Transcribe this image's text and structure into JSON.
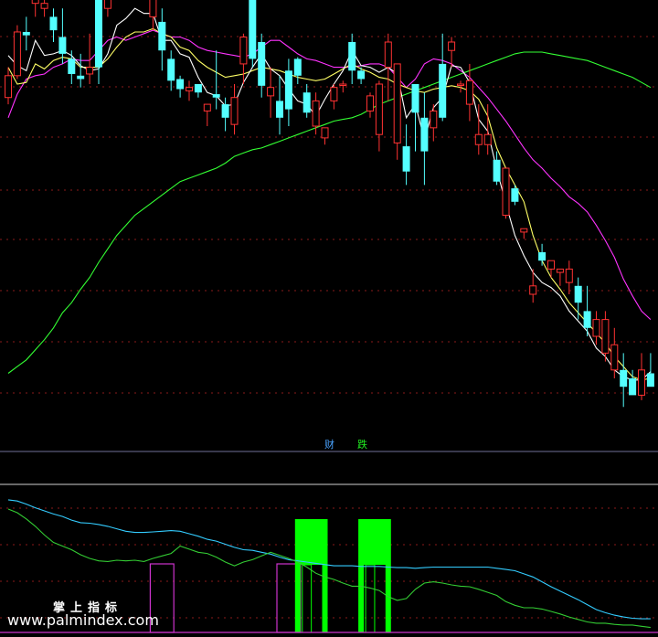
{
  "watermark": {
    "line1": "掌上指标",
    "line2": "www.palmindex.com"
  },
  "indicator_labels": [
    {
      "text": "财",
      "color": "#4aa3ff"
    },
    {
      "text": "跌",
      "color": "#22ee22"
    }
  ],
  "colors": {
    "up": "#ff3232",
    "down": "#54ffff",
    "ma5": "#ffffff",
    "ma10": "#ffff66",
    "ma20": "#ff33ff",
    "ma60": "#33ff33",
    "grid": "#8a1a1a",
    "separator": "#6f6f99",
    "sub_white": "#e6e6e6",
    "sub_cyan": "#33ccff",
    "sub_green": "#33cc33",
    "sub_magenta": "#cc33cc",
    "signal_fill": "#00ff00"
  },
  "chart_data": [
    {
      "type": "candlestick",
      "title": "",
      "candles": [
        [
          92,
          105,
          88,
          110
        ],
        [
          105,
          131,
          103,
          135
        ],
        [
          131,
          129,
          120,
          140
        ],
        [
          148,
          152,
          140,
          157
        ],
        [
          145,
          148,
          140,
          165
        ],
        [
          140,
          132,
          125,
          145
        ],
        [
          128,
          118,
          112,
          145
        ],
        [
          115,
          106,
          100,
          120
        ],
        [
          105,
          103,
          98,
          118
        ],
        [
          106,
          110,
          100,
          130
        ],
        [
          150,
          110,
          100,
          155
        ],
        [
          145,
          173,
          140,
          178
        ],
        [
          176,
          190,
          170,
          195
        ],
        [
          190,
          175,
          170,
          195
        ],
        [
          168,
          185,
          160,
          195
        ],
        [
          186,
          162,
          158,
          190
        ],
        [
          140,
          160,
          132,
          162
        ],
        [
          137,
          120,
          108,
          145
        ],
        [
          115,
          102,
          96,
          120
        ],
        [
          103,
          97,
          92,
          105
        ],
        [
          96,
          98,
          90,
          102
        ],
        [
          100,
          95,
          92,
          100
        ],
        [
          84,
          88,
          75,
          88
        ],
        [
          94,
          92,
          85,
          120
        ],
        [
          88,
          80,
          72,
          92
        ],
        [
          76,
          92,
          70,
          100
        ],
        [
          112,
          128,
          100,
          130
        ],
        [
          150,
          115,
          110,
          170
        ],
        [
          125,
          99,
          92,
          130
        ],
        [
          93,
          98,
          80,
          110
        ],
        [
          90,
          80,
          70,
          105
        ],
        [
          108,
          85,
          75,
          115
        ],
        [
          115,
          105,
          100,
          116
        ],
        [
          95,
          83,
          80,
          100
        ],
        [
          75,
          90,
          70,
          95
        ],
        [
          68,
          74,
          64,
          72
        ],
        [
          90,
          98,
          85,
          100
        ],
        [
          100,
          100,
          95,
          102
        ],
        [
          125,
          108,
          100,
          130
        ],
        [
          108,
          103,
          100,
          110
        ],
        [
          84,
          93,
          80,
          95
        ],
        [
          70,
          100,
          60,
          102
        ],
        [
          110,
          125,
          90,
          130
        ],
        [
          65,
          112,
          55,
          112
        ],
        [
          63,
          48,
          40,
          76
        ],
        [
          100,
          83,
          60,
          100
        ],
        [
          80,
          60,
          40,
          95
        ],
        [
          74,
          84,
          66,
          88
        ],
        [
          112,
          80,
          78,
          130
        ],
        [
          120,
          125,
          110,
          128
        ],
        [
          100,
          100,
          95,
          102
        ],
        [
          88,
          102,
          78,
          112
        ],
        [
          64,
          70,
          58,
          88
        ],
        [
          64,
          70,
          58,
          88
        ],
        [
          55,
          42,
          40,
          60
        ],
        [
          22,
          50,
          20,
          50
        ],
        [
          38,
          30,
          28,
          40
        ],
        [
          12,
          14,
          8,
          14
        ],
        [
          -25,
          -20,
          -30,
          -10
        ],
        [
          0,
          -5,
          -8,
          5
        ],
        [
          -10,
          -5,
          -15,
          -5
        ],
        [
          -12,
          -10,
          -20,
          -10
        ],
        [
          -18,
          -10,
          -25,
          -5
        ],
        [
          -20,
          -30,
          -40,
          -15
        ],
        [
          -35,
          -45,
          -50,
          -20
        ],
        [
          -50,
          -40,
          -55,
          -35
        ],
        [
          -60,
          -40,
          -65,
          -35
        ],
        [
          -70,
          -55,
          -75,
          -45
        ],
        [
          -70,
          -80,
          -92,
          -60
        ],
        [
          -75,
          -85,
          -82,
          -70
        ],
        [
          -85,
          -70,
          -88,
          -60
        ],
        [
          -72,
          -80,
          -72,
          -60
        ]
      ],
      "ma5": [
        117,
        111,
        108,
        126,
        117,
        118,
        120,
        117,
        111,
        108,
        109,
        118,
        135,
        139,
        145,
        142,
        142,
        126,
        126,
        118,
        116,
        104,
        95,
        93,
        87,
        88,
        101,
        110,
        118,
        109,
        105,
        97,
        90,
        88,
        81,
        91,
        100,
        108,
        120,
        111,
        110,
        107,
        110,
        106,
        80,
        88,
        67,
        86,
        92,
        111,
        110,
        101,
        79,
        72,
        49,
        29,
        10,
        -2,
        -12,
        -18,
        -21,
        -26,
        -35,
        -41,
        -47,
        -57,
        -62,
        -70,
        -74,
        -76,
        -76,
        -71
      ],
      "ma10": [
        110,
        100,
        101,
        112,
        109,
        114,
        116,
        115,
        110,
        110,
        110,
        115,
        122,
        128,
        131,
        131,
        133,
        130,
        128,
        122,
        120,
        114,
        110,
        107,
        104,
        105,
        106,
        108,
        110,
        109,
        108,
        106,
        104,
        103,
        102,
        103,
        106,
        109,
        112,
        109,
        107,
        104,
        103,
        100,
        98,
        96,
        95,
        97,
        98,
        99,
        98,
        96,
        91,
        81,
        62,
        50,
        40,
        30,
        10,
        -5,
        -15,
        -22,
        -30,
        -36,
        -42,
        -48,
        -54,
        -62,
        -68,
        -74,
        -76,
        -75
      ],
      "ma20": [
        80,
        94,
        103,
        105,
        106,
        110,
        112,
        115,
        114,
        114,
        120,
        126,
        128,
        126,
        128,
        130,
        132,
        130,
        128,
        128,
        126,
        122,
        120,
        119,
        118,
        117,
        116,
        118,
        122,
        126,
        126,
        122,
        118,
        115,
        114,
        112,
        110,
        110,
        110,
        111,
        112,
        112,
        110,
        104,
        98,
        103,
        112,
        115,
        114,
        112,
        108,
        104,
        98,
        92,
        85,
        78,
        70,
        62,
        55,
        50,
        44,
        39,
        33,
        29,
        24,
        16,
        7,
        -3,
        -16,
        -26,
        -35,
        -40
      ],
      "ma60": [
        -72,
        -68,
        -64,
        -58,
        -52,
        -45,
        -36,
        -30,
        -22,
        -15,
        -6,
        2,
        10,
        16,
        22,
        26,
        30,
        34,
        38,
        42,
        44,
        46,
        48,
        50,
        53,
        57,
        59,
        61,
        62,
        64,
        66,
        68,
        70,
        72,
        74,
        76,
        78,
        79,
        80,
        82,
        85,
        88,
        90,
        92,
        94,
        96,
        98,
        100,
        102,
        104,
        106,
        108,
        110,
        112,
        114,
        116,
        118,
        119,
        119,
        119,
        118,
        117,
        116,
        115,
        114,
        112,
        110,
        108,
        106,
        104,
        101,
        98
      ],
      "ylim": [
        -100,
        150
      ],
      "grid": true
    },
    {
      "type": "line",
      "title": "",
      "series": [
        {
          "color": "#33ccff",
          "values": [
            95,
            93,
            88,
            82,
            77,
            72,
            68,
            62,
            58,
            57,
            55,
            52,
            48,
            44,
            42,
            42,
            43,
            44,
            45,
            44,
            40,
            36,
            31,
            28,
            23,
            18,
            14,
            13,
            10,
            7,
            2,
            -2,
            -4,
            -6,
            -8,
            -10,
            -12,
            -12,
            -12,
            -13,
            -13,
            -13,
            -14,
            -15,
            -15,
            -16,
            -15,
            -14,
            -14,
            -14,
            -14,
            -14,
            -14,
            -14,
            -16,
            -18,
            -20,
            -25,
            -30,
            -38,
            -46,
            -53,
            -60,
            -67,
            -75,
            -83,
            -88,
            -92,
            -95,
            -97,
            -98,
            -98
          ]
        },
        {
          "color": "#33cc33",
          "values": [
            80,
            74,
            64,
            52,
            38,
            26,
            20,
            14,
            6,
            0,
            -4,
            -5,
            -3,
            -4,
            -3,
            -5,
            0,
            4,
            8,
            20,
            15,
            10,
            8,
            2,
            -6,
            -12,
            -6,
            -2,
            4,
            10,
            5,
            0,
            -6,
            -14,
            -24,
            -30,
            -34,
            -40,
            -45,
            -45,
            -48,
            -52,
            -62,
            -68,
            -65,
            -50,
            -40,
            -38,
            -40,
            -43,
            -45,
            -46,
            -50,
            -55,
            -60,
            -70,
            -76,
            -80,
            -80,
            -82,
            -86,
            -90,
            -95,
            -99,
            -103,
            -105,
            -105,
            -107,
            -108,
            -108,
            -110,
            -112
          ]
        }
      ],
      "signals": [
        {
          "type": "outline",
          "color": "#cc33cc",
          "from": 16,
          "to": 18
        },
        {
          "type": "outline",
          "color": "#cc33cc",
          "from": 30,
          "to": 32
        },
        {
          "type": "fill",
          "color": "#00ff00",
          "from": 32,
          "to": 35
        },
        {
          "type": "fill",
          "color": "#00ff00",
          "from": 39,
          "to": 42
        }
      ],
      "ylim": [
        -120,
        120
      ],
      "grid": true
    }
  ]
}
